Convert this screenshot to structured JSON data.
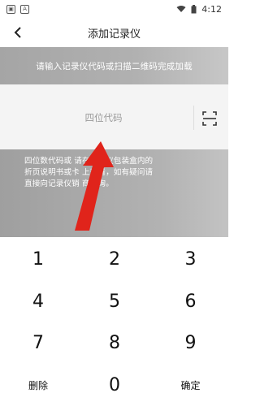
{
  "status_bar": {
    "time": "4:12",
    "left_icons": [
      "notification-app-icon",
      "notification-app-icon"
    ],
    "right_icons": [
      "wifi-icon",
      "battery-icon"
    ]
  },
  "header": {
    "title": "添加记录仪",
    "back_icon": "chevron-left-icon"
  },
  "instruction": {
    "text": "请输入记录仪代码或扫描二维码完成加载"
  },
  "code_input": {
    "placeholder": "四位代码",
    "value": "",
    "scan_icon": "scan-icon"
  },
  "hint": {
    "line1": "四位数代码或            请在记录仪包装盒内的",
    "line2": "折页说明书或卡        上查看，如有疑问请",
    "line3": "直接向记录仪销     商咨询。"
  },
  "keypad": {
    "keys": [
      "1",
      "2",
      "3",
      "4",
      "5",
      "6",
      "7",
      "8",
      "9",
      "删除",
      "0",
      "确定"
    ]
  },
  "colors": {
    "band": "#b1b1b1",
    "arrow": "#e0241b",
    "input_bg": "#f4f4f4"
  }
}
